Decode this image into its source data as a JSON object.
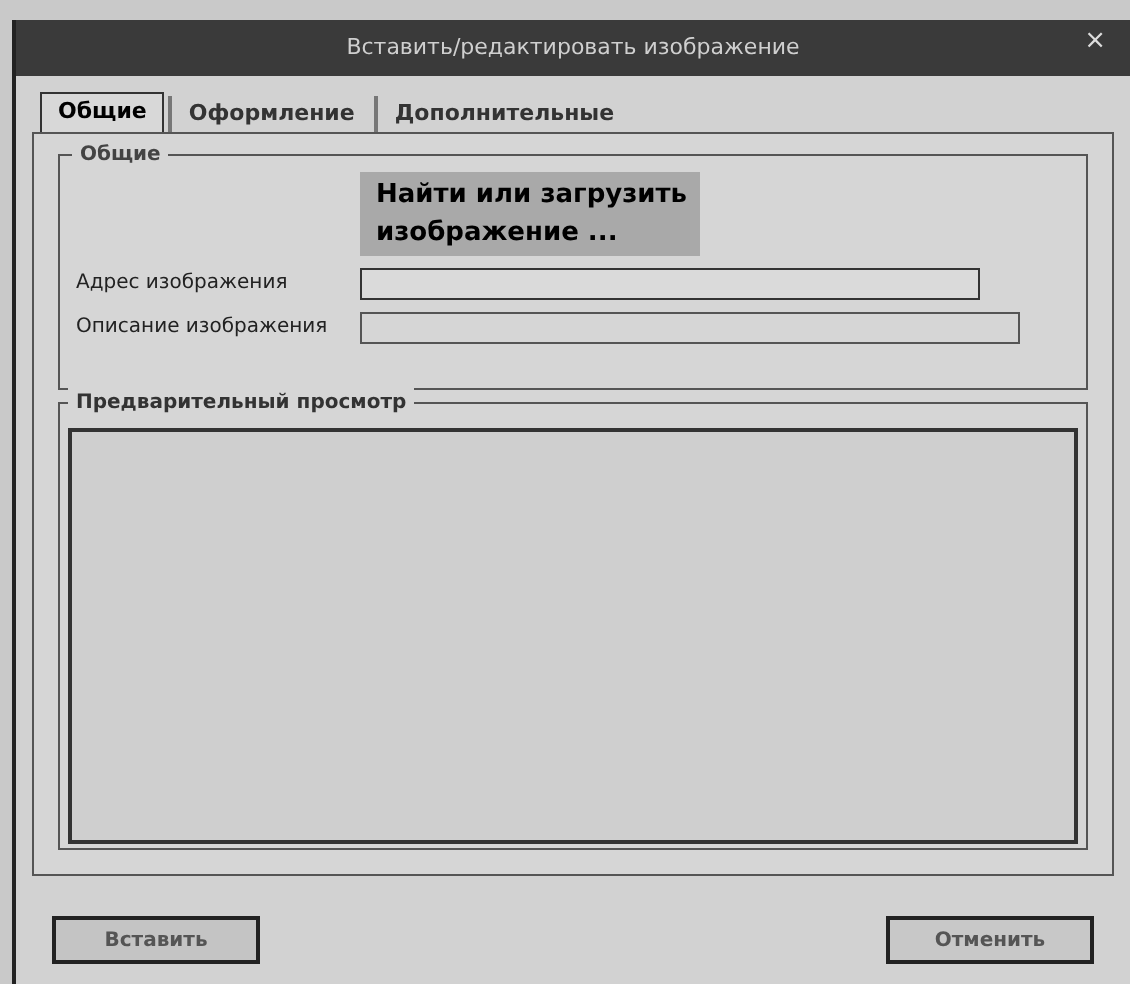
{
  "window": {
    "title": "Вставить/редактировать изображение",
    "close": "×"
  },
  "tabs": [
    {
      "label": "Общие",
      "selected": true
    },
    {
      "label": "Оформление",
      "selected": false
    },
    {
      "label": "Дополнительные",
      "selected": false
    }
  ],
  "general": {
    "legend": "Общие",
    "search_button": "Найти или загрузить изображение ...",
    "fields": [
      {
        "label": "Адрес изображения"
      },
      {
        "label": "Описание изображения"
      }
    ]
  },
  "preview": {
    "legend": "Предварительный просмотр"
  },
  "buttons": [
    {
      "label": "Вставить"
    },
    {
      "label": "Отменить"
    }
  ]
}
